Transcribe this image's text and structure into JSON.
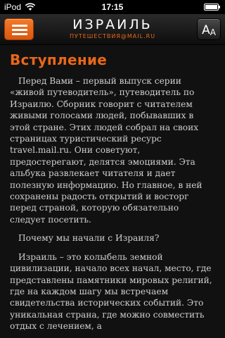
{
  "status_bar": {
    "carrier": "iPod",
    "time": "17:15"
  },
  "nav": {
    "title": "ИЗРАИЛЬ",
    "subtitle": "ПУТЕШЕСТВИЯ@MAIL.RU",
    "font_size_big": "A",
    "font_size_small": "A"
  },
  "article": {
    "title": "Вступление",
    "paragraphs": [
      "Перед Вами – первый выпуск серии «живой путеводитель», путеводитель по Израилю. Сборник говорит с читателем живыми голосами людей, побывавших в этой стране. Этих людей собрал на своих страницах туристический ресурс travel.mail.ru. Они советуют, предостерегают, делятся эмоциями. Эта альбука развлекает читателя и дает полезную информацию. Но главное, в ней сохранены радость открытий и восторг перед страной, которую обязательно следует посетить.",
      "Почему мы начали с Израиля?",
      "Израиль – это колыбель земной цивилизации, начало всех начал, место, где представлены памятники мировых религий, где на каждом шагу мы встречаем свидетельства исторических событий. Это уникальная страна, где можно совместить отдых с лечением, а"
    ]
  },
  "colors": {
    "accent": "#e8671a",
    "background": "#111111",
    "text": "#cfcfcf"
  },
  "icons": {
    "menu": "hamburger-menu-icon",
    "wifi": "wifi-icon",
    "battery": "battery-icon"
  }
}
